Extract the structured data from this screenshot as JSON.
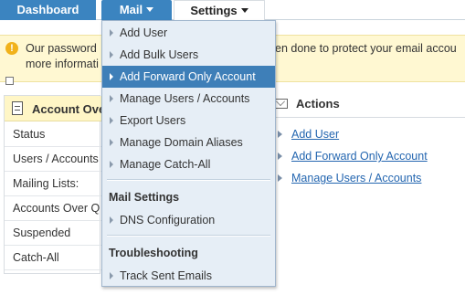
{
  "nav": {
    "dashboard": "Dashboard",
    "mail": "Mail",
    "settings": "Settings"
  },
  "notice": {
    "left_line1": "Our password",
    "left_line2": "more informati",
    "right_line1": "en done to protect your email accou"
  },
  "account_overview": {
    "title": "Account Ove",
    "rows": [
      "Status",
      "Users / Accounts",
      "Mailing Lists:",
      "Accounts Over Q",
      "Suspended",
      "Catch-All"
    ]
  },
  "actions": {
    "title": "Actions",
    "links": [
      "Add User",
      "Add Forward Only Account",
      "Manage Users / Accounts"
    ]
  },
  "mail_menu": {
    "items": [
      "Add User",
      "Add Bulk Users",
      "Add Forward Only Account",
      "Manage Users / Accounts",
      "Export Users",
      "Manage Domain Aliases",
      "Manage Catch-All"
    ],
    "active_index": 2,
    "mail_settings_heading": "Mail Settings",
    "mail_settings_items": [
      "DNS Configuration"
    ],
    "troubleshooting_heading": "Troubleshooting",
    "troubleshooting_items": [
      "Track Sent Emails"
    ]
  },
  "icons": {
    "notice": "warning-icon",
    "account_overview": "document-icon",
    "actions": "envelope-icon",
    "menu_item": "triangle-right-icon",
    "nav_dropdown": "caret-down-icon"
  },
  "colors": {
    "nav_active": "#3b84c0",
    "menu_active": "#3e7fb8",
    "menu_bg": "#e6eef6",
    "notice_bg": "#fff8d2",
    "link": "#2466b0"
  }
}
